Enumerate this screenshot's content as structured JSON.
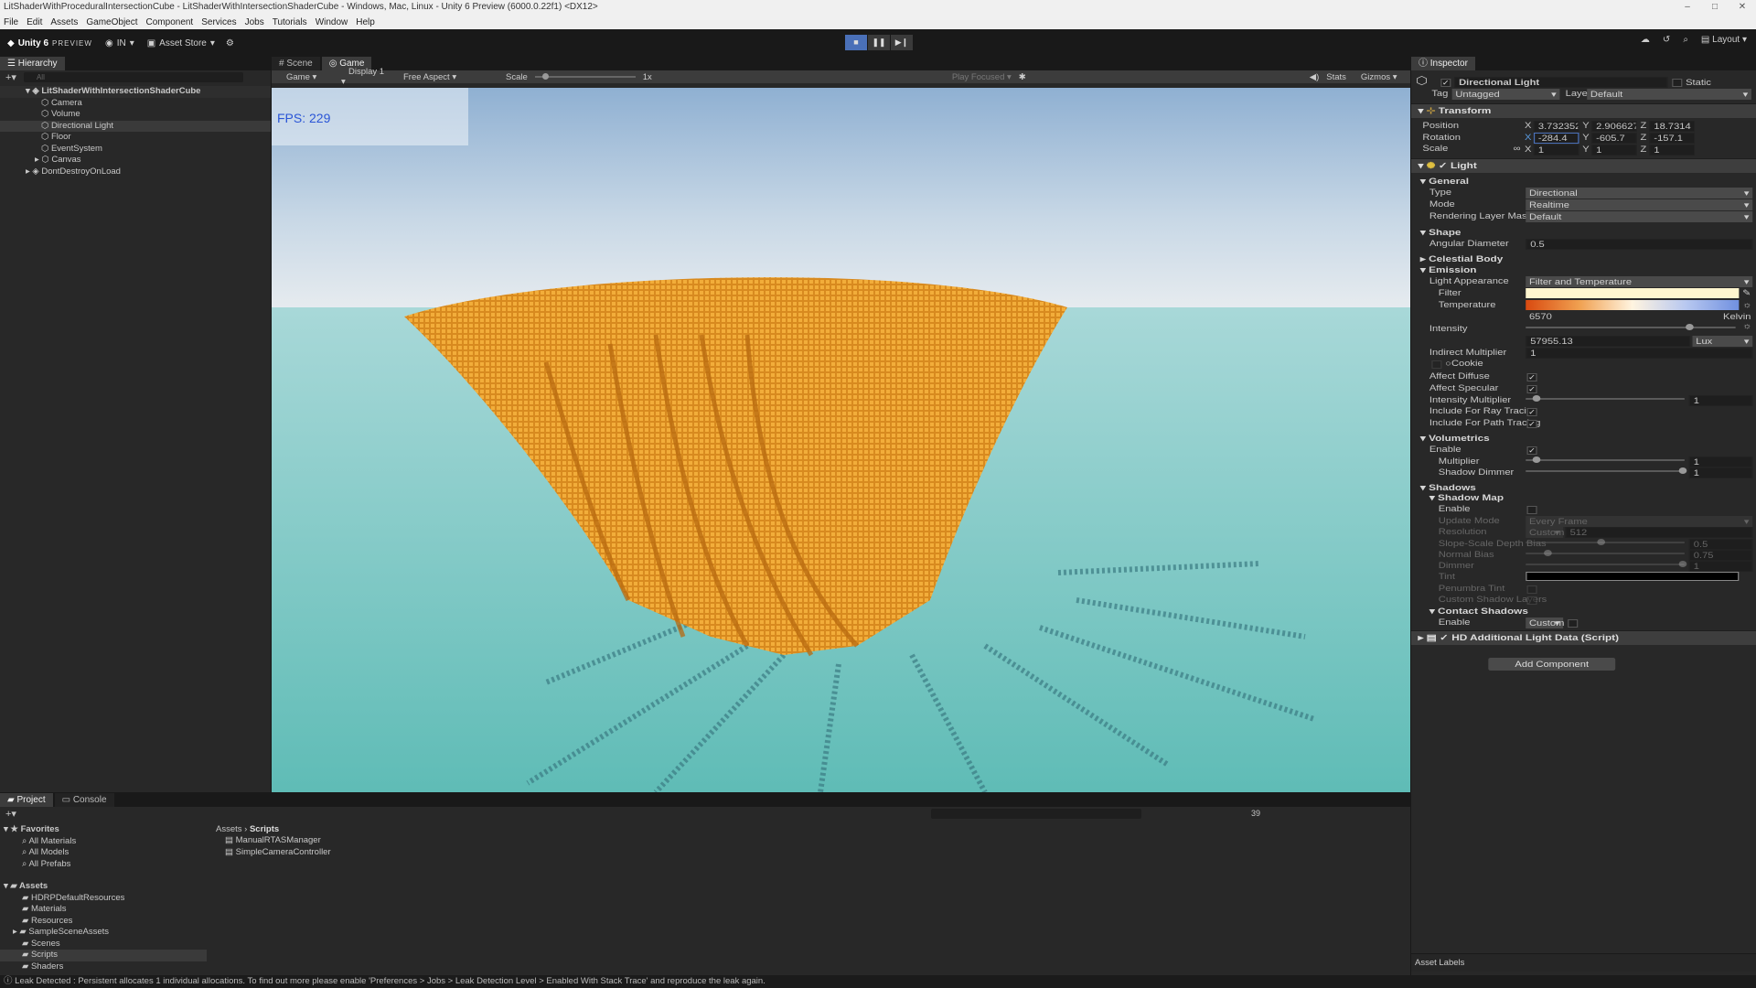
{
  "window": {
    "title": "LitShaderWithProceduralIntersectionCube - LitShaderWithIntersectionShaderCube - Windows, Mac, Linux - Unity 6 Preview (6000.0.22f1) <DX12>",
    "controls": [
      "–",
      "□",
      "✕"
    ]
  },
  "menu": [
    "File",
    "Edit",
    "Assets",
    "GameObject",
    "Component",
    "Services",
    "Jobs",
    "Tutorials",
    "Window",
    "Help"
  ],
  "toolbar": {
    "brand": "Unity 6",
    "preview": "PREVIEW",
    "account": "IN",
    "asset_store": "Asset Store",
    "layout": "Layout"
  },
  "hierarchy": {
    "tab": "Hierarchy",
    "search_placeholder": "All",
    "scene": "LitShaderWithIntersectionShaderCube",
    "items": [
      "Camera",
      "Volume",
      "Directional Light",
      "Floor",
      "EventSystem",
      "Canvas"
    ],
    "selected_index": 2,
    "ddol": "DontDestroyOnLoad"
  },
  "gameview": {
    "tabs": [
      "Scene",
      "Game"
    ],
    "mode": "Game",
    "display": "Display 1",
    "aspect": "Free Aspect",
    "scale_label": "Scale",
    "scale_value": "1x",
    "play_focused": "Play Focused",
    "stats": "Stats",
    "gizmos": "Gizmos",
    "fps": "FPS: 229"
  },
  "inspector": {
    "tab": "Inspector",
    "object_name": "Directional Light",
    "static_label": "Static",
    "tag_label": "Tag",
    "tag_value": "Untagged",
    "layer_label": "Layer",
    "layer_value": "Default",
    "transform": {
      "title": "Transform",
      "position_label": "Position",
      "rotation_label": "Rotation",
      "scale_label": "Scale",
      "position": [
        "3.732352",
        "2.906627",
        "18.7314"
      ],
      "rotation": [
        "-284.4",
        "-605.7",
        "-157.1"
      ],
      "scale": [
        "1",
        "1",
        "1"
      ],
      "axes": [
        "X",
        "Y",
        "Z"
      ]
    },
    "light": {
      "title": "Light",
      "general": "General",
      "type_label": "Type",
      "type_value": "Directional",
      "mode_label": "Mode",
      "mode_value": "Realtime",
      "rlm_label": "Rendering Layer Mask",
      "rlm_value": "Default",
      "shape": "Shape",
      "angular_label": "Angular Diameter",
      "angular_value": "0.5",
      "celestial": "Celestial Body",
      "emission": "Emission",
      "appearance_label": "Light Appearance",
      "appearance_value": "Filter and Temperature",
      "filter_label": "Filter",
      "temp_label": "Temperature",
      "temp_value": "6570",
      "kelvin": "Kelvin",
      "intensity_label": "Intensity",
      "intensity_value": "57955.13",
      "lux": "Lux",
      "indirect_label": "Indirect Multiplier",
      "indirect_value": "1",
      "cookie_label": "Cookie",
      "affect_diffuse": "Affect Diffuse",
      "affect_specular": "Affect Specular",
      "int_mult_label": "Intensity Multiplier",
      "int_mult_value": "1",
      "ray_tracing": "Include For Ray Tracing",
      "path_tracing": "Include For Path Tracing",
      "volumetrics": "Volumetrics",
      "vol_enable": "Enable",
      "vol_mult_label": "Multiplier",
      "vol_mult_value": "1",
      "shadow_dimmer_label": "Shadow Dimmer",
      "shadow_dimmer_value": "1",
      "shadows": "Shadows",
      "shadow_map": "Shadow Map",
      "sm_enable": "Enable",
      "update_mode_label": "Update Mode",
      "update_mode_value": "Every Frame",
      "resolution_label": "Resolution",
      "resolution_value": "Custom",
      "resolution_num": "512",
      "slope_label": "Slope-Scale Depth Bias",
      "slope_value": "0.5",
      "normal_label": "Normal Bias",
      "normal_value": "0.75",
      "dimmer_label": "Dimmer",
      "dimmer_value": "1",
      "tint_label": "Tint",
      "penumbra_label": "Penumbra Tint",
      "custom_layers_label": "Custom Shadow Layers",
      "contact": "Contact Shadows",
      "cs_enable": "Enable",
      "cs_value": "Custom"
    },
    "hd_data": "HD Additional Light Data (Script)",
    "add_component": "Add Component",
    "asset_labels": "Asset Labels"
  },
  "project": {
    "tabs": [
      "Project",
      "Console"
    ],
    "favorites": "Favorites",
    "fav_items": [
      "All Materials",
      "All Models",
      "All Prefabs"
    ],
    "assets": "Assets",
    "asset_folders": [
      "HDRPDefaultResources",
      "Materials",
      "Resources",
      "SampleSceneAssets",
      "Scenes",
      "Scripts",
      "Shaders"
    ],
    "breadcrumb": [
      "Assets",
      "Scripts"
    ],
    "files": [
      "ManualRTASManager",
      "SimpleCameraController"
    ],
    "count": "39"
  },
  "status": "Leak Detected : Persistent allocates 1 individual allocations. To find out more please enable 'Preferences > Jobs > Leak Detection Level > Enabled With Stack Trace' and reproduce the leak again.",
  "colors": {
    "accent": "#4a70b8",
    "sky_top": "#8fb2d6",
    "water": "#6fc3c0",
    "structure": "#e39a2b"
  }
}
